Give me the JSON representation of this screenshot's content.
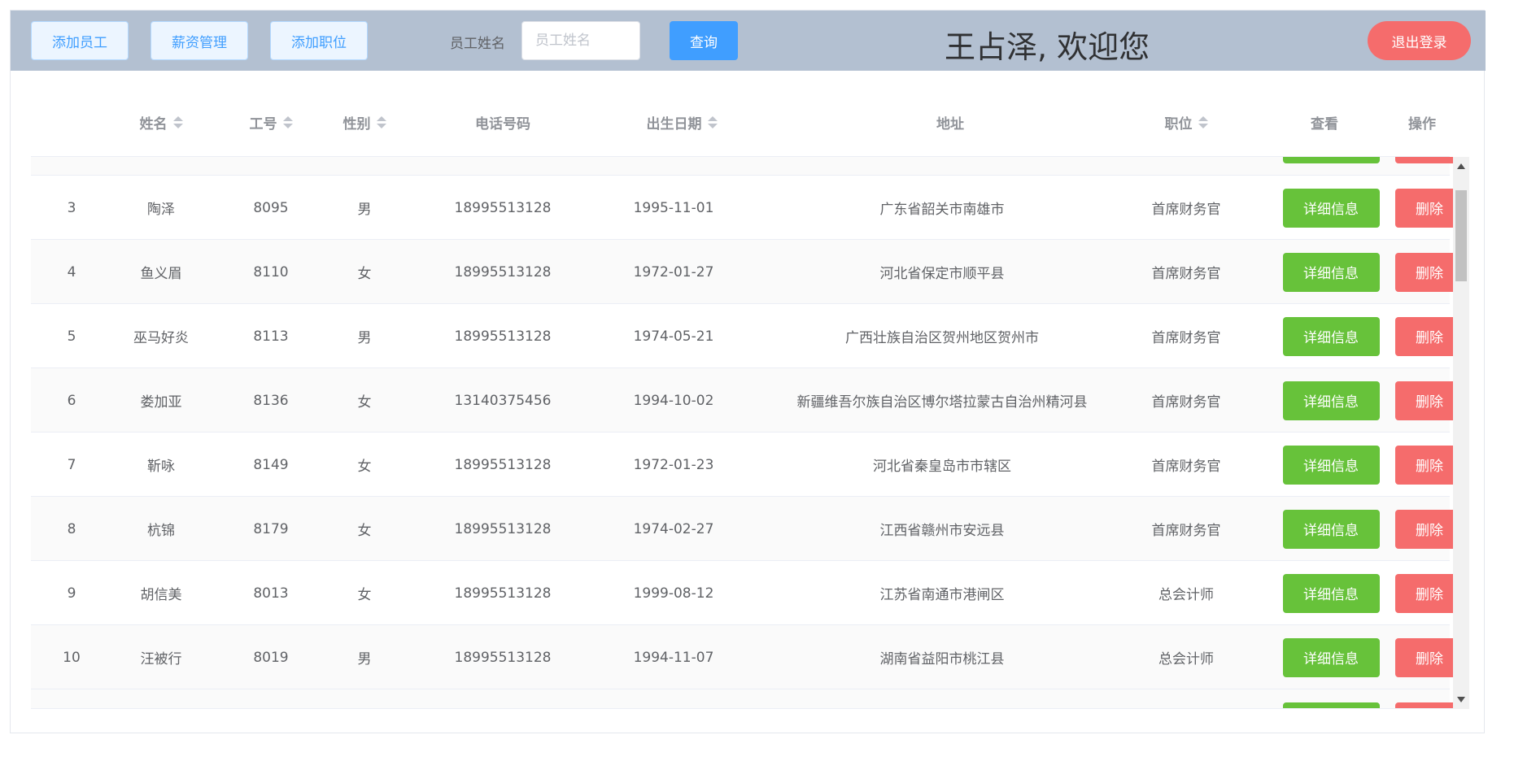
{
  "header": {
    "buttons": {
      "add_employee": "添加员工",
      "salary_management": "薪资管理",
      "add_position": "添加职位"
    },
    "search": {
      "label": "员工姓名",
      "placeholder": "员工姓名",
      "value": "",
      "query_label": "查询"
    },
    "welcome": "王占泽, 欢迎您",
    "logout_label": "退出登录",
    "colors": {
      "bar": "#b3c0d1",
      "primary": "#409eff",
      "success": "#67c23a",
      "danger": "#f56c6c"
    }
  },
  "table": {
    "columns": {
      "name": "姓名",
      "emp_no": "工号",
      "gender": "性别",
      "phone": "电话号码",
      "birth": "出生日期",
      "address": "地址",
      "position": "职位",
      "view": "查看",
      "ops": "操作"
    },
    "sort_icon": "sort-caret-icon",
    "rows": [
      {
        "idx": "3",
        "name": "陶泽",
        "emp_no": "8095",
        "gender": "男",
        "phone": "18995513128",
        "birth": "1995-11-01",
        "address": "广东省韶关市南雄市",
        "position": "首席财务官",
        "detail": "详细信息",
        "delete": "删除"
      },
      {
        "idx": "4",
        "name": "鱼义眉",
        "emp_no": "8110",
        "gender": "女",
        "phone": "18995513128",
        "birth": "1972-01-27",
        "address": "河北省保定市顺平县",
        "position": "首席财务官",
        "detail": "详细信息",
        "delete": "删除"
      },
      {
        "idx": "5",
        "name": "巫马好炎",
        "emp_no": "8113",
        "gender": "男",
        "phone": "18995513128",
        "birth": "1974-05-21",
        "address": "广西壮族自治区贺州地区贺州市",
        "position": "首席财务官",
        "detail": "详细信息",
        "delete": "删除"
      },
      {
        "idx": "6",
        "name": "娄加亚",
        "emp_no": "8136",
        "gender": "女",
        "phone": "13140375456",
        "birth": "1994-10-02",
        "address": "新疆维吾尔族自治区博尔塔拉蒙古自治州精河县",
        "position": "首席财务官",
        "detail": "详细信息",
        "delete": "删除"
      },
      {
        "idx": "7",
        "name": "靳咏",
        "emp_no": "8149",
        "gender": "女",
        "phone": "18995513128",
        "birth": "1972-01-23",
        "address": "河北省秦皇岛市市辖区",
        "position": "首席财务官",
        "detail": "详细信息",
        "delete": "删除"
      },
      {
        "idx": "8",
        "name": "杭锦",
        "emp_no": "8179",
        "gender": "女",
        "phone": "18995513128",
        "birth": "1974-02-27",
        "address": "江西省赣州市安远县",
        "position": "首席财务官",
        "detail": "详细信息",
        "delete": "删除"
      },
      {
        "idx": "9",
        "name": "胡信美",
        "emp_no": "8013",
        "gender": "女",
        "phone": "18995513128",
        "birth": "1999-08-12",
        "address": "江苏省南通市港闸区",
        "position": "总会计师",
        "detail": "详细信息",
        "delete": "删除"
      },
      {
        "idx": "10",
        "name": "汪被行",
        "emp_no": "8019",
        "gender": "男",
        "phone": "18995513128",
        "birth": "1994-11-07",
        "address": "湖南省益阳市桃江县",
        "position": "总会计师",
        "detail": "详细信息",
        "delete": "删除"
      }
    ]
  }
}
